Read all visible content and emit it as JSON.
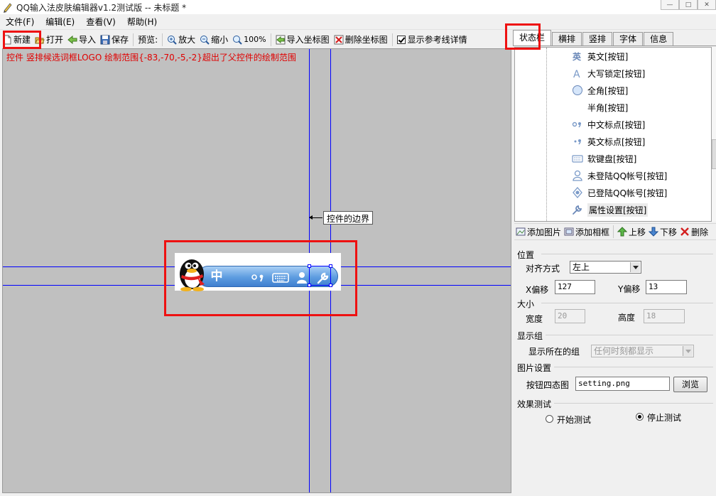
{
  "window": {
    "title": "QQ输入法皮肤编辑器v1.2测试版 -- 未标题 *"
  },
  "menu": [
    "文件(F)",
    "编辑(E)",
    "查看(V)",
    "帮助(H)"
  ],
  "toolbar": {
    "new": "新建",
    "open": "打开",
    "import": "导入",
    "save": "保存",
    "preview": "预览:",
    "zoom_in": "放大",
    "zoom_out": "缩小",
    "zoom_100": "100%",
    "import_coord": "导入坐标图",
    "delete_coord": "删除坐标图",
    "show_guides": "显示参考线详情",
    "show_guides_checked": true
  },
  "canvas": {
    "error_message": "控件 竖排候选词框LOGO 绘制范围{-83,-70,-5,-2}超出了父控件的绘制范围",
    "boundary_label": "控件的边界",
    "qq_bar_text": "中",
    "accent_color": "#0000ff",
    "highlight_color": "#ee1111"
  },
  "tabs": [
    "状态栏",
    "横排",
    "竖排",
    "字体",
    "信息"
  ],
  "tree_items": [
    {
      "label": "英文[按钮]",
      "icon": "english-icon"
    },
    {
      "label": "大写锁定[按钮]",
      "icon": "capslock-icon"
    },
    {
      "label": "全角[按钮]",
      "icon": "fullwidth-icon"
    },
    {
      "label": "半角[按钮]",
      "icon": "halfwidth-icon"
    },
    {
      "label": "中文标点[按钮]",
      "icon": "cn-punct-icon"
    },
    {
      "label": "英文标点[按钮]",
      "icon": "en-punct-icon"
    },
    {
      "label": "软键盘[按钮]",
      "icon": "keyboard-icon"
    },
    {
      "label": "未登陆QQ帐号[按钮]",
      "icon": "user-offline-icon"
    },
    {
      "label": "已登陆QQ帐号[按钮]",
      "icon": "user-online-icon"
    },
    {
      "label": "属性设置[按钮]",
      "icon": "wrench-icon"
    }
  ],
  "subtoolbar": {
    "add_image": "添加图片",
    "add_frame": "添加相框",
    "move_up": "上移",
    "move_down": "下移",
    "delete": "删除"
  },
  "props": {
    "position_group": "位置",
    "align_label": "对齐方式",
    "align_value": "左上",
    "x_label": "X偏移",
    "x_value": "127",
    "y_label": "Y偏移",
    "y_value": "13",
    "size_group": "大小",
    "width_label": "宽度",
    "width_value": "20",
    "height_label": "高度",
    "height_value": "18",
    "display_group": "显示组",
    "display_label": "显示所在的组",
    "display_value": "任何时刻都显示",
    "image_group": "图片设置",
    "image_label": "按钮四态图",
    "image_value": "setting.png",
    "browse": "浏览",
    "effect_group": "效果测试",
    "start_test": "开始测试",
    "stop_test": "停止测试",
    "stop_selected": true
  }
}
